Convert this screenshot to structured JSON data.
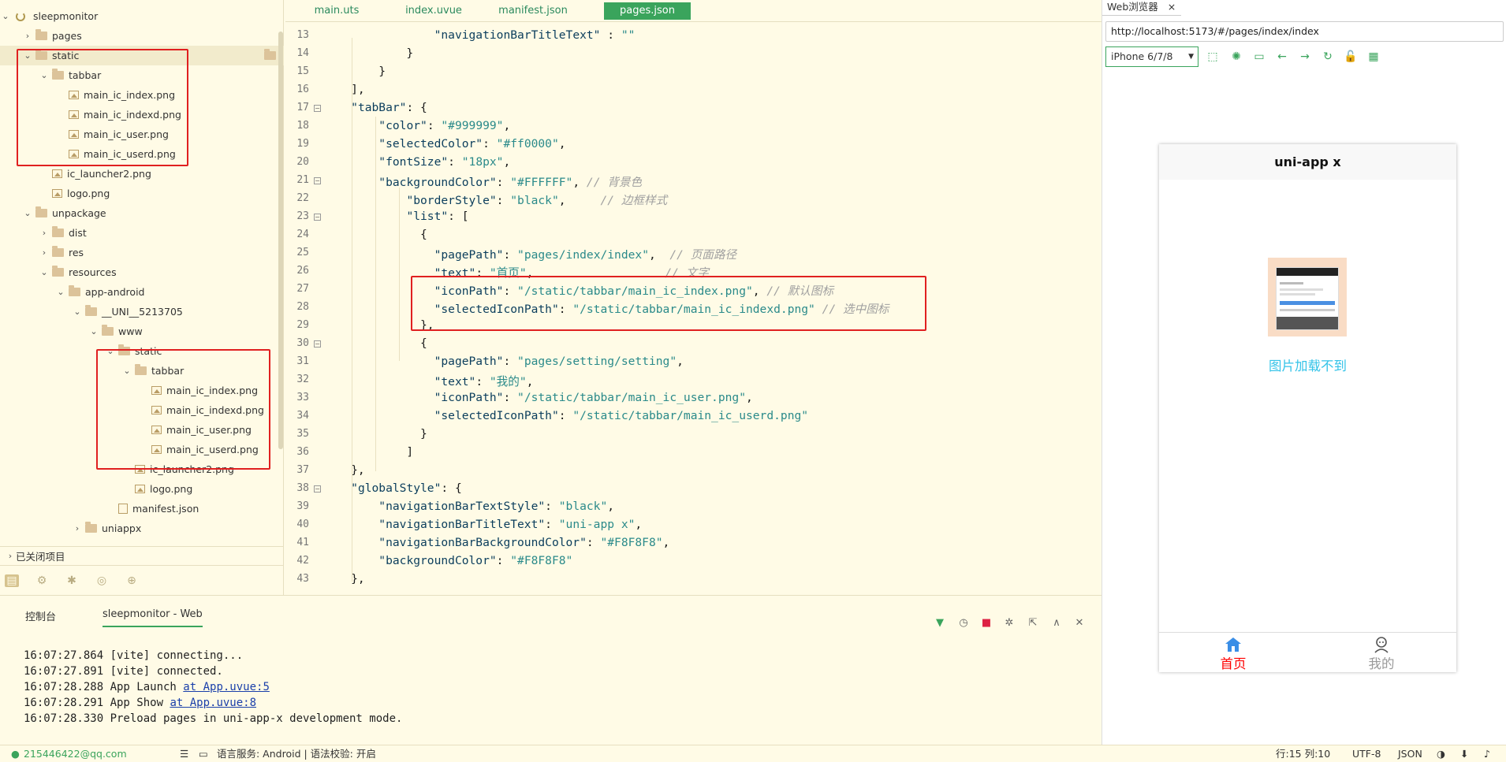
{
  "explorer": {
    "root": "sleepmonitor",
    "items": [
      {
        "label": "pages",
        "depth": 1,
        "type": "folder",
        "state": "closed"
      },
      {
        "label": "static",
        "depth": 1,
        "type": "folder",
        "state": "open",
        "selected": true
      },
      {
        "label": "tabbar",
        "depth": 2,
        "type": "folder",
        "state": "open"
      },
      {
        "label": "main_ic_index.png",
        "depth": 3,
        "type": "image"
      },
      {
        "label": "main_ic_indexd.png",
        "depth": 3,
        "type": "image"
      },
      {
        "label": "main_ic_user.png",
        "depth": 3,
        "type": "image"
      },
      {
        "label": "main_ic_userd.png",
        "depth": 3,
        "type": "image"
      },
      {
        "label": "ic_launcher2.png",
        "depth": 2,
        "type": "image"
      },
      {
        "label": "logo.png",
        "depth": 2,
        "type": "image"
      },
      {
        "label": "unpackage",
        "depth": 1,
        "type": "folder",
        "state": "open"
      },
      {
        "label": "dist",
        "depth": 2,
        "type": "folder",
        "state": "closed"
      },
      {
        "label": "res",
        "depth": 2,
        "type": "folder",
        "state": "closed"
      },
      {
        "label": "resources",
        "depth": 2,
        "type": "folder",
        "state": "open"
      },
      {
        "label": "app-android",
        "depth": 3,
        "type": "folder",
        "state": "open"
      },
      {
        "label": "__UNI__5213705",
        "depth": 4,
        "type": "folder",
        "state": "open"
      },
      {
        "label": "www",
        "depth": 5,
        "type": "folder",
        "state": "open"
      },
      {
        "label": "static",
        "depth": 6,
        "type": "folder",
        "state": "open"
      },
      {
        "label": "tabbar",
        "depth": 7,
        "type": "folder",
        "state": "open"
      },
      {
        "label": "main_ic_index.png",
        "depth": 8,
        "type": "image"
      },
      {
        "label": "main_ic_indexd.png",
        "depth": 8,
        "type": "image"
      },
      {
        "label": "main_ic_user.png",
        "depth": 8,
        "type": "image"
      },
      {
        "label": "main_ic_userd.png",
        "depth": 8,
        "type": "image"
      },
      {
        "label": "ic_launcher2.png",
        "depth": 7,
        "type": "image"
      },
      {
        "label": "logo.png",
        "depth": 7,
        "type": "image"
      },
      {
        "label": "manifest.json",
        "depth": 6,
        "type": "json"
      },
      {
        "label": "uniappx",
        "depth": 4,
        "type": "folder",
        "state": "closed"
      }
    ],
    "closed_projects": "已关闭项目"
  },
  "editor": {
    "tabs": [
      "main.uts",
      "index.uvue",
      "manifest.json",
      "pages.json"
    ],
    "active_tab": "pages.json",
    "lines": [
      {
        "n": "13",
        "t": "                \"navigationBarTitleText\" : \"\""
      },
      {
        "n": "14",
        "t": "            }"
      },
      {
        "n": "15",
        "t": "        }"
      },
      {
        "n": "16",
        "t": "    ],"
      },
      {
        "n": "17",
        "t": "    \"tabBar\": {"
      },
      {
        "n": "18",
        "t": "        \"color\": \"#999999\","
      },
      {
        "n": "19",
        "t": "        \"selectedColor\": \"#ff0000\","
      },
      {
        "n": "20",
        "t": "        \"fontSize\": \"18px\","
      },
      {
        "n": "21",
        "t": "        \"backgroundColor\": \"#FFFFFF\", // 背景色"
      },
      {
        "n": "22",
        "t": "            \"borderStyle\": \"black\",     // 边框样式"
      },
      {
        "n": "23",
        "t": "            \"list\": ["
      },
      {
        "n": "24",
        "t": "              {"
      },
      {
        "n": "25",
        "t": "                \"pagePath\": \"pages/index/index\",  // 页面路径"
      },
      {
        "n": "26",
        "t": "                \"text\": \"首页\",                   // 文字"
      },
      {
        "n": "27",
        "t": "                \"iconPath\": \"/static/tabbar/main_ic_index.png\", // 默认图标"
      },
      {
        "n": "28",
        "t": "                \"selectedIconPath\": \"/static/tabbar/main_ic_indexd.png\" // 选中图标"
      },
      {
        "n": "29",
        "t": "              },"
      },
      {
        "n": "30",
        "t": "              {"
      },
      {
        "n": "31",
        "t": "                \"pagePath\": \"pages/setting/setting\","
      },
      {
        "n": "32",
        "t": "                \"text\": \"我的\","
      },
      {
        "n": "33",
        "t": "                \"iconPath\": \"/static/tabbar/main_ic_user.png\","
      },
      {
        "n": "34",
        "t": "                \"selectedIconPath\": \"/static/tabbar/main_ic_userd.png\""
      },
      {
        "n": "35",
        "t": "              }"
      },
      {
        "n": "36",
        "t": "            ]"
      },
      {
        "n": "37",
        "t": "    },"
      },
      {
        "n": "38",
        "t": "    \"globalStyle\": {"
      },
      {
        "n": "39",
        "t": "        \"navigationBarTextStyle\": \"black\","
      },
      {
        "n": "40",
        "t": "        \"navigationBarTitleText\": \"uni-app x\","
      },
      {
        "n": "41",
        "t": "        \"navigationBarBackgroundColor\": \"#F8F8F8\","
      },
      {
        "n": "42",
        "t": "        \"backgroundColor\": \"#F8F8F8\""
      },
      {
        "n": "43",
        "t": "    },"
      }
    ]
  },
  "browser": {
    "tab_title": "Web浏览器",
    "url": "http://localhost:5173/#/pages/index/index",
    "device": "iPhone 6/7/8",
    "phone": {
      "nav_title": "uni-app x",
      "image_error": "图片加载不到",
      "tabs": [
        {
          "label": "首页",
          "color": "#ff0000",
          "active": true
        },
        {
          "label": "我的",
          "color": "#999999",
          "active": false
        }
      ]
    }
  },
  "console": {
    "tabs": [
      "控制台",
      "sleepmonitor - Web"
    ],
    "lines": [
      {
        "text": "16:07:27.864 [vite] connecting...",
        "link": ""
      },
      {
        "text": "16:07:27.891 [vite] connected.",
        "link": ""
      },
      {
        "text": "16:07:28.288 App Launch ",
        "link": "at App.uvue:5"
      },
      {
        "text": "16:07:28.291 App Show ",
        "link": "at App.uvue:8"
      },
      {
        "text": "16:07:28.330 Preload pages in uni-app-x development mode.",
        "link": ""
      }
    ]
  },
  "statusbar": {
    "user": "215446422@qq.com",
    "service": "语言服务: Android | 语法校验: 开启",
    "position": "行:15  列:10",
    "encoding": "UTF-8",
    "lang": "JSON"
  },
  "colors": {
    "accent": "#3aa45c",
    "highlight": "#e02020",
    "link": "#33c3e8"
  }
}
